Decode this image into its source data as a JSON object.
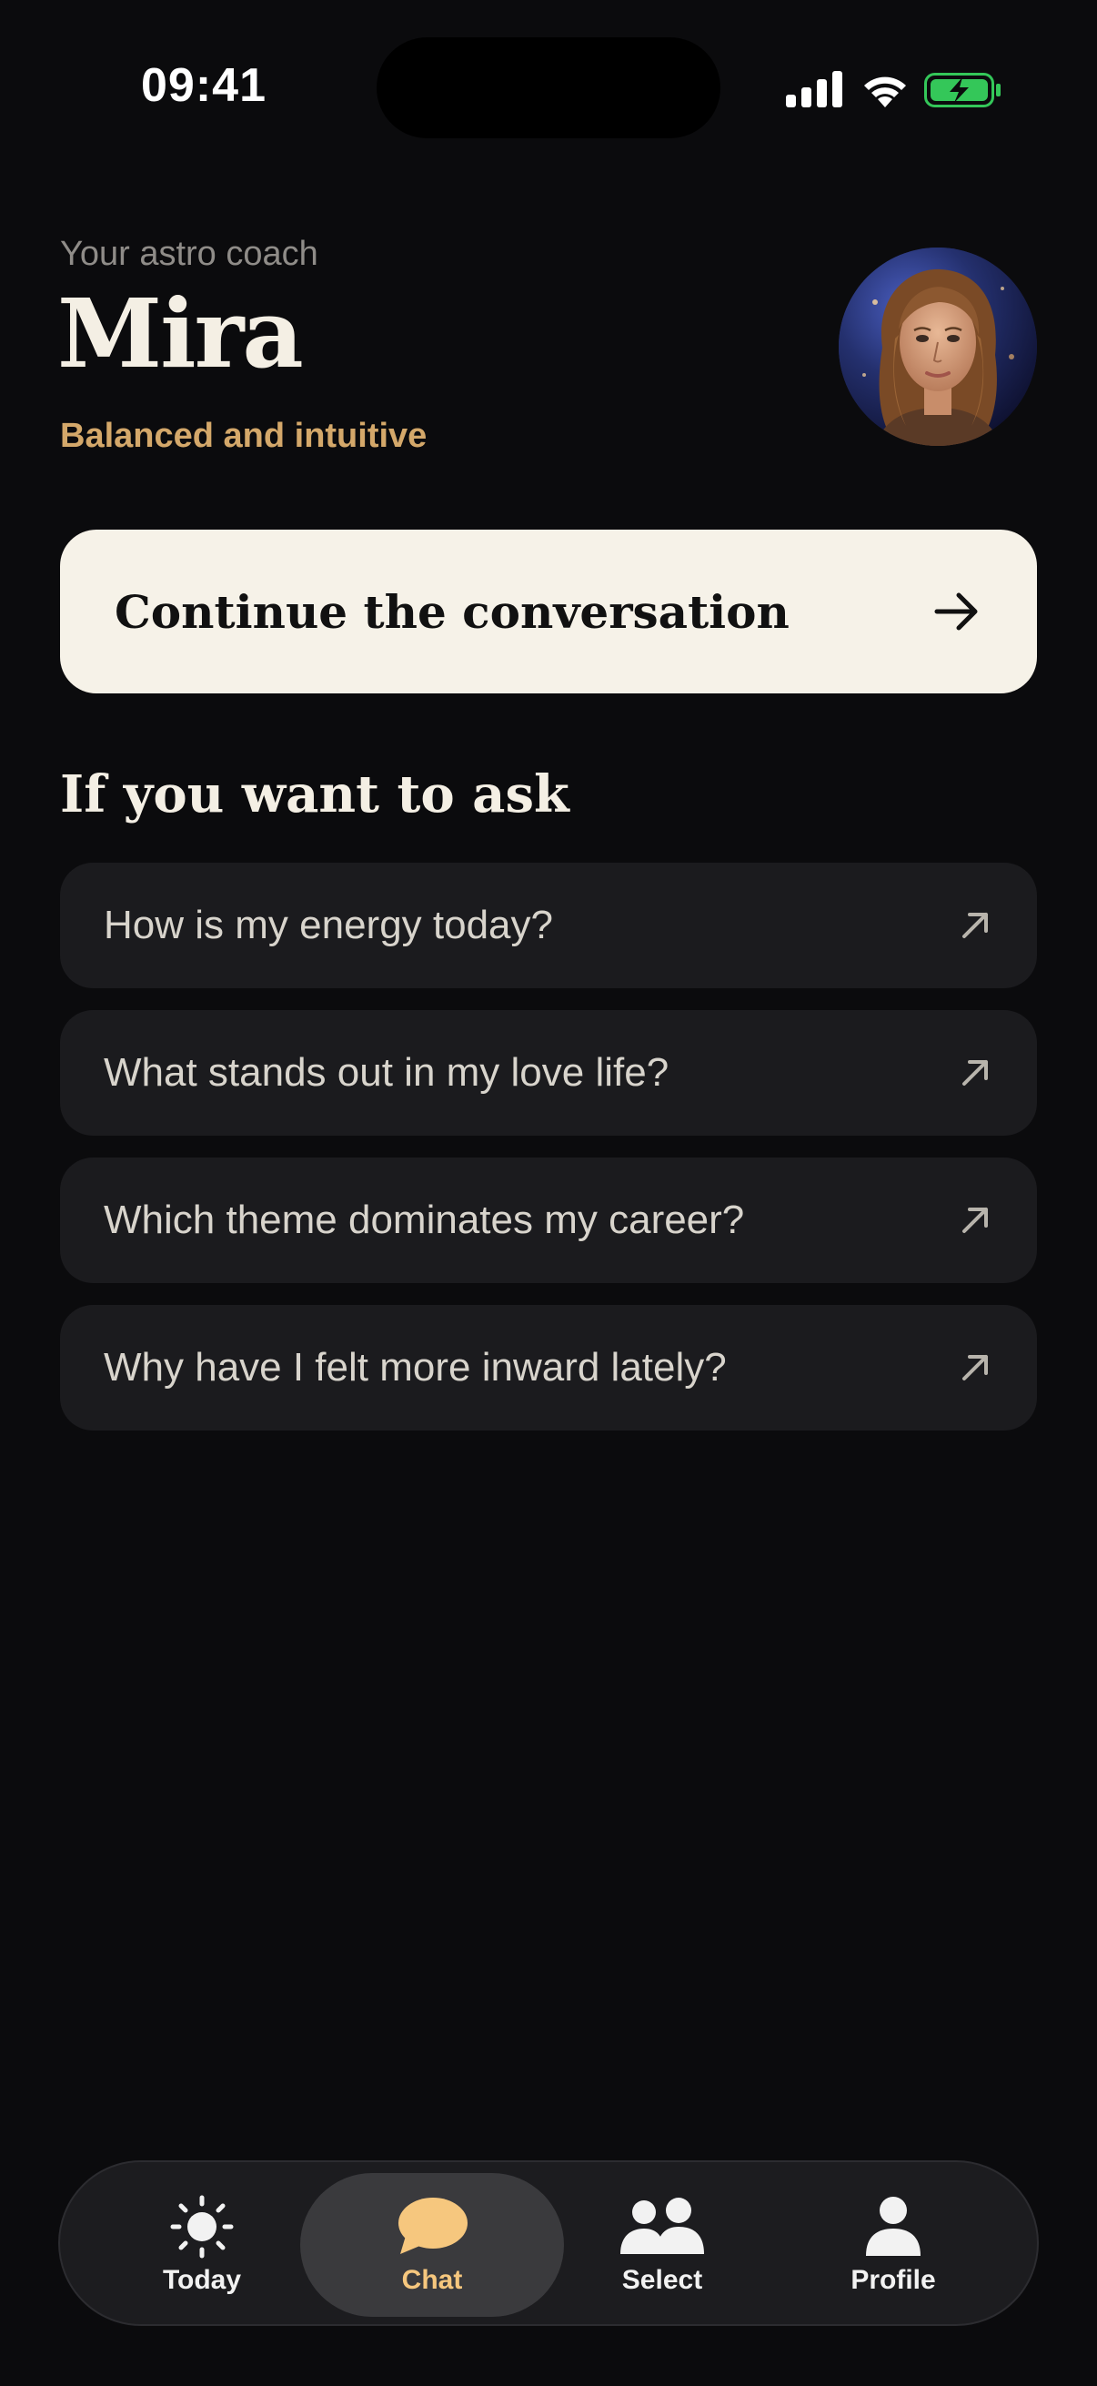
{
  "status_bar": {
    "time": "09:41"
  },
  "header": {
    "subtitle": "Your astro coach",
    "name": "Mira",
    "tagline": "Balanced and intuitive"
  },
  "continue_button": {
    "label": "Continue the conversation"
  },
  "questions": {
    "heading": "If you want to ask",
    "items": [
      "How is my energy today?",
      "What stands out in my love life?",
      "Which theme dominates my career?",
      "Why have I felt more inward lately?"
    ]
  },
  "tab_bar": {
    "tabs": [
      {
        "label": "Today",
        "icon": "sun-icon"
      },
      {
        "label": "Chat",
        "icon": "chat-bubble-icon"
      },
      {
        "label": "Select",
        "icon": "people-icon"
      },
      {
        "label": "Profile",
        "icon": "person-icon"
      }
    ],
    "active": "Chat"
  },
  "colors": {
    "background": "#0b0b0d",
    "accent_gold": "#d4a86a",
    "active_tab": "#f6c77e",
    "card": "#1b1b1e",
    "battery_green": "#34c759"
  }
}
